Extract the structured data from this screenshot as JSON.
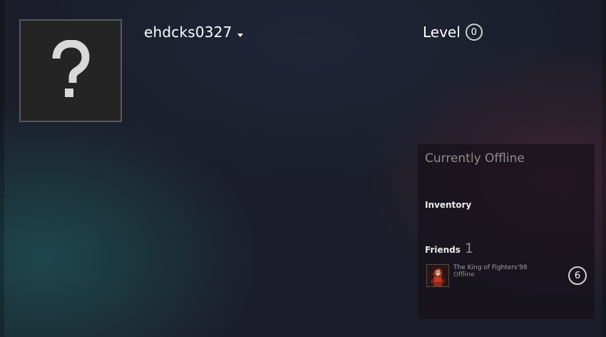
{
  "profile": {
    "username": "ehdcks0327",
    "avatar_glyph": "?",
    "level_label": "Level",
    "level_value": "0"
  },
  "panel": {
    "status": "Currently Offline",
    "inventory_label": "Inventory",
    "friends_label": "Friends",
    "friends_count": "1",
    "friends": [
      {
        "name": "The King of Fighters'98",
        "status": "Offline",
        "level": "6"
      }
    ]
  },
  "icons": {
    "dropdown": "caret-down-icon",
    "avatar_placeholder": "question-mark-icon"
  },
  "colors": {
    "background": "#1b1e2a",
    "panel": "#16111a",
    "muted_text": "#8c8c8c",
    "badge_border": "#cfcfcf"
  }
}
